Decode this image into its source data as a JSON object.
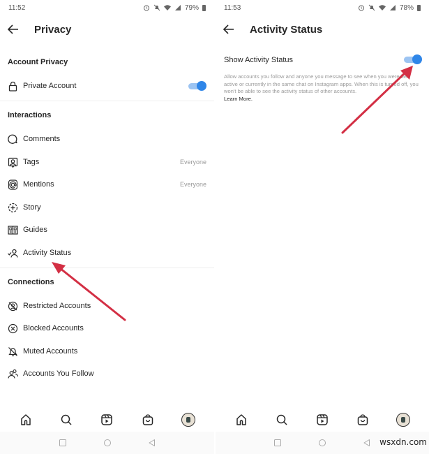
{
  "left_screen": {
    "status_bar": {
      "time": "11:52",
      "battery": "79%"
    },
    "header": {
      "title": "Privacy"
    },
    "sections": [
      {
        "heading": "Account Privacy",
        "items": [
          {
            "label": "Private Account",
            "icon": "lock-icon",
            "toggle_on": true
          }
        ]
      },
      {
        "heading": "Interactions",
        "items": [
          {
            "label": "Comments",
            "icon": "comment-icon",
            "value": ""
          },
          {
            "label": "Tags",
            "icon": "tag-person-icon",
            "value": "Everyone"
          },
          {
            "label": "Mentions",
            "icon": "at-sign-icon",
            "value": "Everyone"
          },
          {
            "label": "Story",
            "icon": "story-add-icon",
            "value": ""
          },
          {
            "label": "Guides",
            "icon": "guides-icon",
            "value": ""
          },
          {
            "label": "Activity Status",
            "icon": "activity-status-icon",
            "value": ""
          }
        ]
      },
      {
        "heading": "Connections",
        "items": [
          {
            "label": "Restricted Accounts",
            "icon": "restricted-icon"
          },
          {
            "label": "Blocked Accounts",
            "icon": "blocked-icon"
          },
          {
            "label": "Muted Accounts",
            "icon": "muted-bell-icon"
          },
          {
            "label": "Accounts You Follow",
            "icon": "people-icon"
          }
        ]
      }
    ]
  },
  "right_screen": {
    "status_bar": {
      "time": "11:53",
      "battery": "78%"
    },
    "header": {
      "title": "Activity Status"
    },
    "setting": {
      "label": "Show Activity Status",
      "toggle_on": true,
      "description": "Allow accounts you follow and anyone you message to see when you were last active or currently in the same chat on Instagram apps. When this is turned off, you won't be able to see the activity status of other accounts.",
      "learn_more": "Learn More."
    }
  },
  "bottom_nav": [
    "home-icon",
    "search-icon",
    "reels-icon",
    "shop-icon",
    "profile-avatar"
  ],
  "system_nav": [
    "recents-icon",
    "home-circle-icon",
    "back-triangle-icon"
  ],
  "watermark": "wsxdn.com",
  "colors": {
    "toggle_knob": "#2f86e8",
    "toggle_track": "#9cc4f2",
    "annotation_arrow": "#d32f44"
  }
}
